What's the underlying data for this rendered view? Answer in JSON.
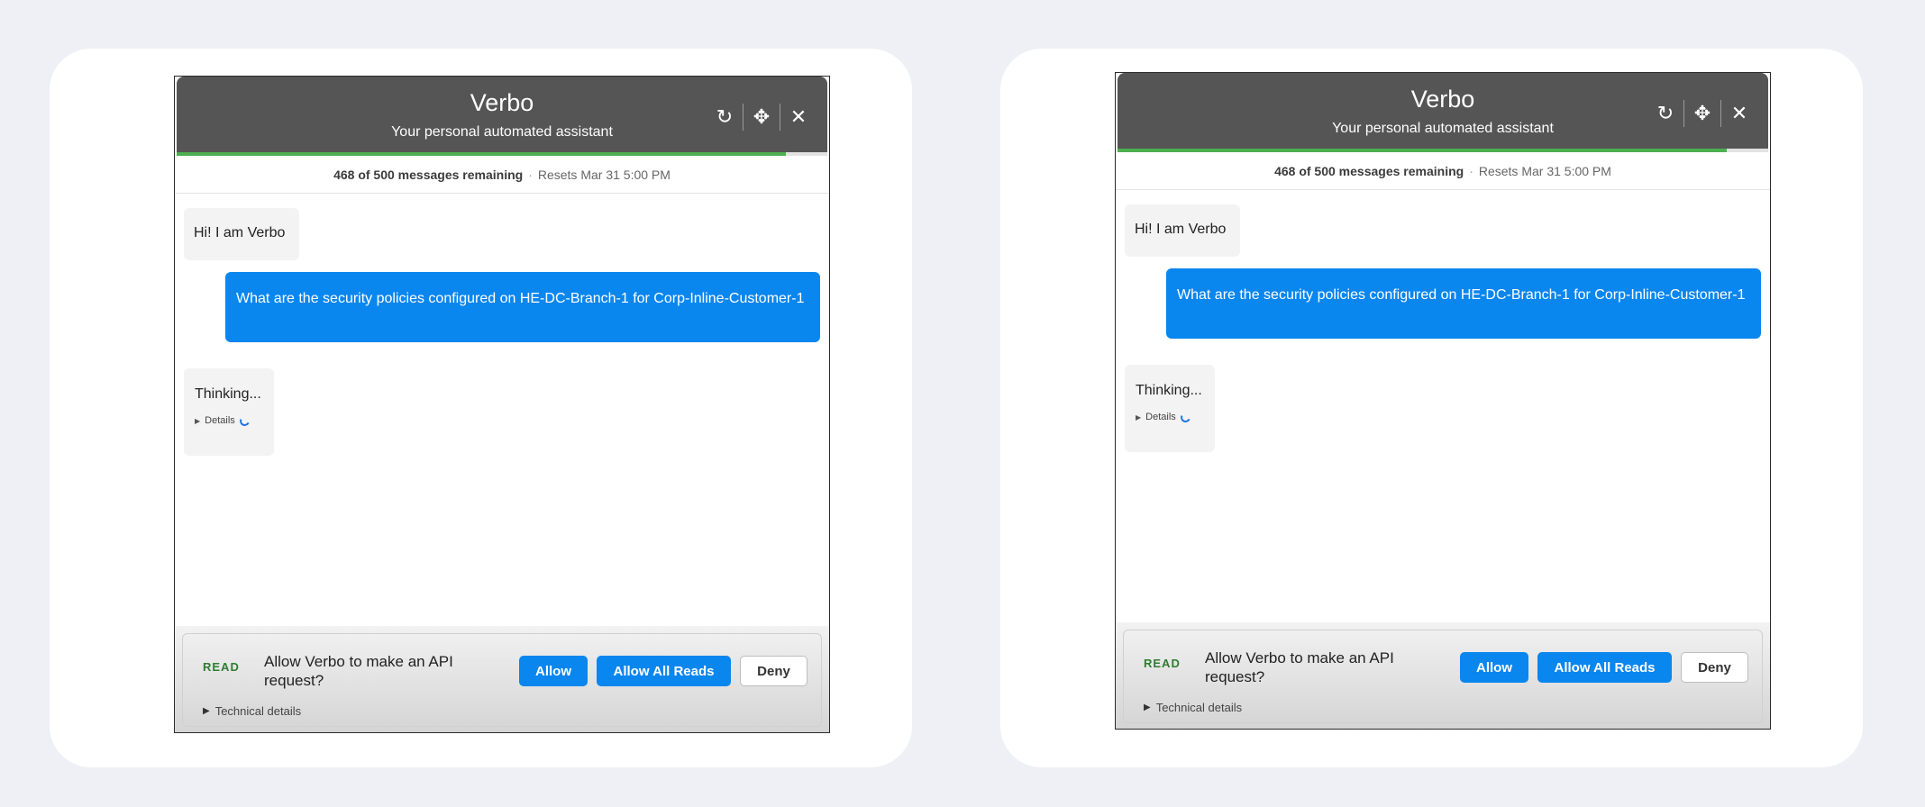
{
  "panels": [
    {
      "header": {
        "title": "Verbo",
        "subtitle": "Your personal automated assistant",
        "icons": [
          "refresh-icon",
          "move-icon",
          "close-icon"
        ],
        "refresh_glyph": "↻",
        "move_glyph": "✥",
        "close_glyph": "✕"
      },
      "progress": {
        "remaining_fraction": 0.936
      },
      "quota": {
        "count": "468 of 500 messages remaining",
        "separator": "·",
        "reset": "Resets Mar 31 5:00 PM"
      },
      "messages": {
        "greeting": "Hi! I am Verbo",
        "user": "What are the security policies configured on HE-DC-Branch-1 for Corp-Inline-Customer-1",
        "thinking": "Thinking...",
        "details": "Details"
      },
      "permission": {
        "badge": "READ",
        "prompt": "Allow Verbo to make an API request?",
        "allow": "Allow",
        "allow_all": "Allow All Reads",
        "deny": "Deny",
        "technical": "Technical details"
      }
    },
    {
      "header": {
        "title": "Verbo",
        "subtitle": "Your personal automated assistant",
        "icons": [
          "refresh-icon",
          "move-icon",
          "close-icon"
        ],
        "refresh_glyph": "↻",
        "move_glyph": "✥",
        "close_glyph": "✕"
      },
      "progress": {
        "remaining_fraction": 0.936
      },
      "quota": {
        "count": "468 of 500 messages remaining",
        "separator": "·",
        "reset": "Resets Mar 31 5:00 PM"
      },
      "messages": {
        "greeting": "Hi! I am Verbo",
        "user": "What are the security policies configured on HE-DC-Branch-1 for Corp-Inline-Customer-1",
        "thinking": "Thinking...",
        "details": "Details"
      },
      "permission": {
        "badge": "READ",
        "prompt": "Allow Verbo to make an API request?",
        "allow": "Allow",
        "allow_all": "Allow All Reads",
        "deny": "Deny",
        "technical": "Technical details"
      }
    }
  ],
  "colors": {
    "page_bg": "#eef0f5",
    "header_bg": "#555555",
    "accent_blue": "#0a86ef",
    "progress_green": "#4caf50",
    "read_badge": "#2e7d32"
  }
}
